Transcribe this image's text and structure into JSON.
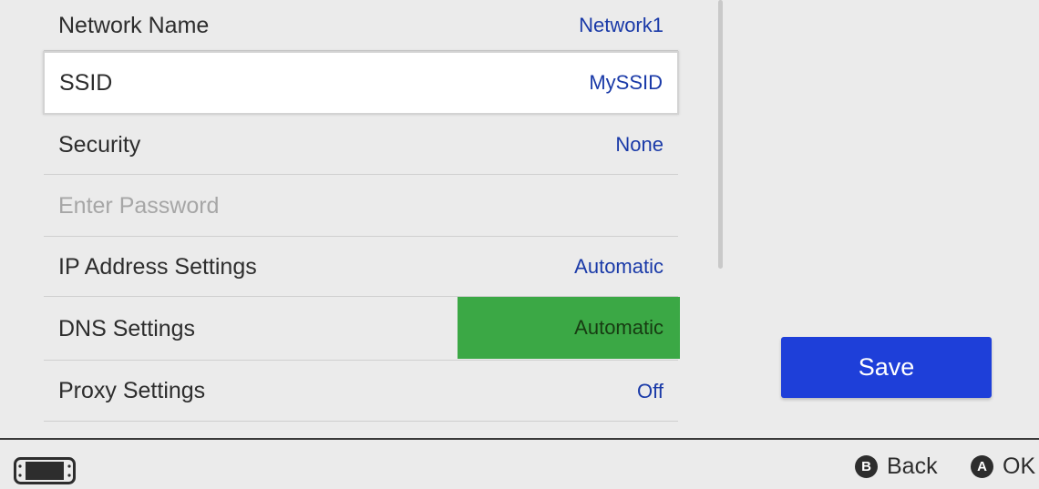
{
  "settings": {
    "network_name": {
      "label": "Network Name",
      "value": "Network1"
    },
    "ssid": {
      "label": "SSID",
      "value": "MySSID"
    },
    "security": {
      "label": "Security",
      "value": "None"
    },
    "password": {
      "label": "Enter Password"
    },
    "ip_address": {
      "label": "IP Address Settings",
      "value": "Automatic"
    },
    "dns": {
      "label": "DNS Settings",
      "value": "Automatic"
    },
    "proxy": {
      "label": "Proxy Settings",
      "value": "Off"
    }
  },
  "save_button": {
    "label": "Save"
  },
  "footer": {
    "console_icon": "handheld-console-icon",
    "back": {
      "glyph": "B",
      "label": "Back"
    },
    "ok": {
      "glyph": "A",
      "label": "OK"
    }
  },
  "colors": {
    "value_text": "#1a3aa8",
    "dns_highlight": "#3ba845",
    "save_button": "#1e3fd9",
    "background": "#ebebeb"
  }
}
